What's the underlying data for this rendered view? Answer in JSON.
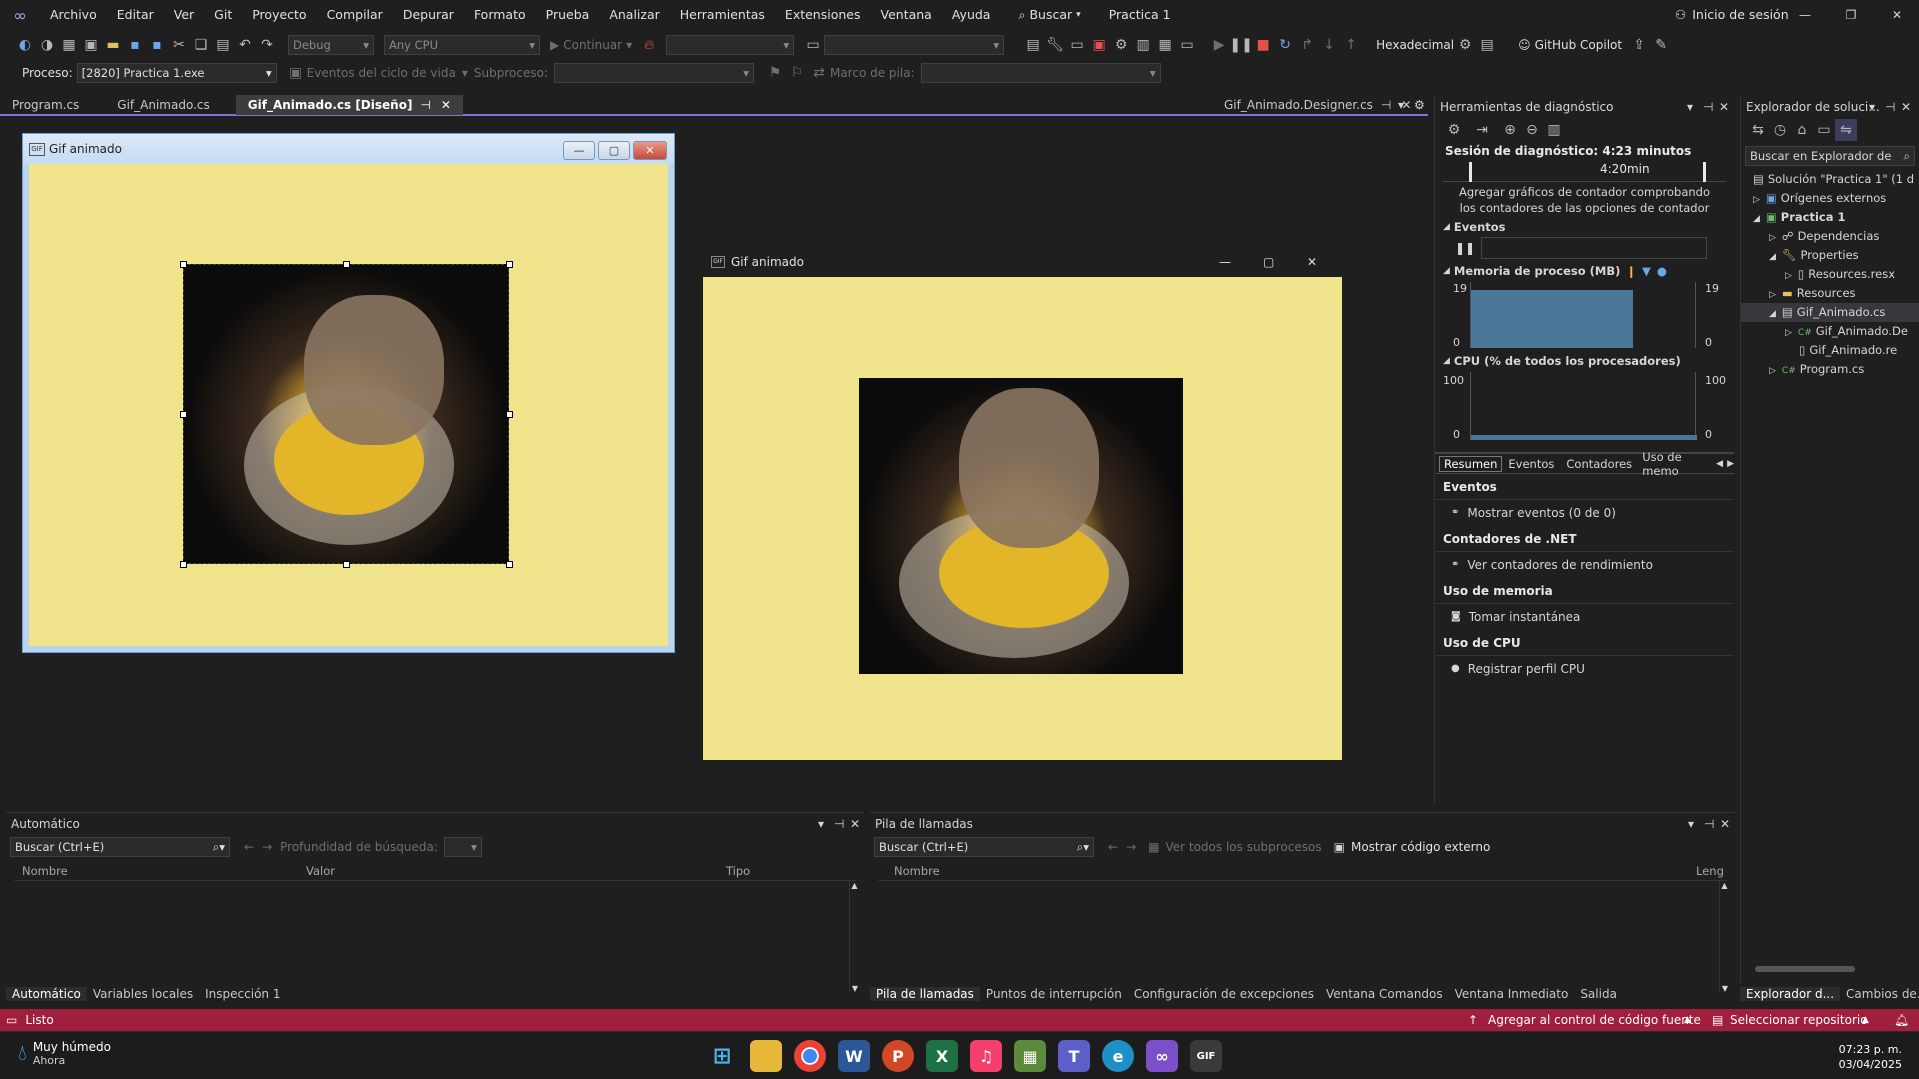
{
  "menubar": {
    "items": [
      "Archivo",
      "Editar",
      "Ver",
      "Git",
      "Proyecto",
      "Compilar",
      "Depurar",
      "Formato",
      "Prueba",
      "Analizar",
      "Herramientas",
      "Extensiones",
      "Ventana",
      "Ayuda"
    ],
    "search_label": "Buscar",
    "solution_name": "Practica 1",
    "signin_label": "Inicio de sesión"
  },
  "toolbar": {
    "config": "Debug",
    "platform": "Any CPU",
    "continue_label": "Continuar",
    "hex_label": "Hexadecimal",
    "copilot_label": "GitHub Copilot",
    "process_label": "Proceso:",
    "process_value": "[2820] Practica 1.exe",
    "lifecycle_label": "Eventos del ciclo de vida",
    "thread_label": "Subproceso:",
    "stackframe_label": "Marco de pila:"
  },
  "doc_tabs": {
    "tabs": [
      "Program.cs",
      "Gif_Animado.cs",
      "Gif_Animado.cs [Diseño]"
    ],
    "right_tab": "Gif_Animado.Designer.cs"
  },
  "designer_form": {
    "title": "Gif animado"
  },
  "running_form": {
    "title": "Gif animado"
  },
  "diagnostics": {
    "title": "Herramientas de diagnóstico",
    "session": "Sesión de diagnóstico: 4:23 minutos",
    "timeline_mark": "4:20min",
    "hint": "Agregar gráficos de contador comprobando los contadores de las opciones de contador",
    "events_head": "Eventos",
    "memory_head": "Memoria de proceso (MB)",
    "mem_max": "19",
    "mem_min": "0",
    "cpu_head": "CPU (% de todos los procesadores)",
    "cpu_max": "100",
    "cpu_min": "0",
    "tabs": [
      "Resumen",
      "Eventos",
      "Contadores",
      "Uso de memo"
    ],
    "sections": [
      {
        "head": "Eventos",
        "item": "Mostrar eventos (0 de 0)"
      },
      {
        "head": "Contadores de .NET",
        "item": "Ver contadores de rendimiento"
      },
      {
        "head": "Uso de memoria",
        "item": "Tomar instantánea"
      },
      {
        "head": "Uso de CPU",
        "item": "Registrar perfil CPU"
      }
    ]
  },
  "explorer": {
    "title": "Explorador de soluci...",
    "search_placeholder": "Buscar en Explorador de",
    "items": [
      "Solución \"Practica 1\" (1 d",
      "Orígenes externos",
      "Practica 1",
      "Dependencias",
      "Properties",
      "Resources.resx",
      "Resources",
      "Gif_Animado.cs",
      "Gif_Animado.De",
      "Gif_Animado.re",
      "Program.cs"
    ],
    "bottom_tabs": [
      "Explorador d...",
      "Cambios de..."
    ]
  },
  "auto_panel": {
    "title": "Automático",
    "search_placeholder": "Buscar (Ctrl+E)",
    "depth_label": "Profundidad de búsqueda:",
    "columns": [
      "Nombre",
      "Valor",
      "Tipo"
    ],
    "tabs": [
      "Automático",
      "Variables locales",
      "Inspección 1"
    ]
  },
  "stack_panel": {
    "title": "Pila de llamadas",
    "search_placeholder": "Buscar (Ctrl+E)",
    "all_threads": "Ver todos los subprocesos",
    "external_code": "Mostrar código externo",
    "columns": [
      "Nombre",
      "Leng"
    ],
    "tabs": [
      "Pila de llamadas",
      "Puntos de interrupción",
      "Configuración de excepciones",
      "Ventana Comandos",
      "Ventana Inmediato",
      "Salida"
    ]
  },
  "statusbar": {
    "status": "Listo",
    "source_control": "Agregar al control de código fuente",
    "repo": "Seleccionar repositorio"
  },
  "taskbar": {
    "weather_title": "Muy húmedo",
    "weather_sub": "Ahora",
    "time": "07:23 p. m.",
    "date": "03/04/2025"
  }
}
